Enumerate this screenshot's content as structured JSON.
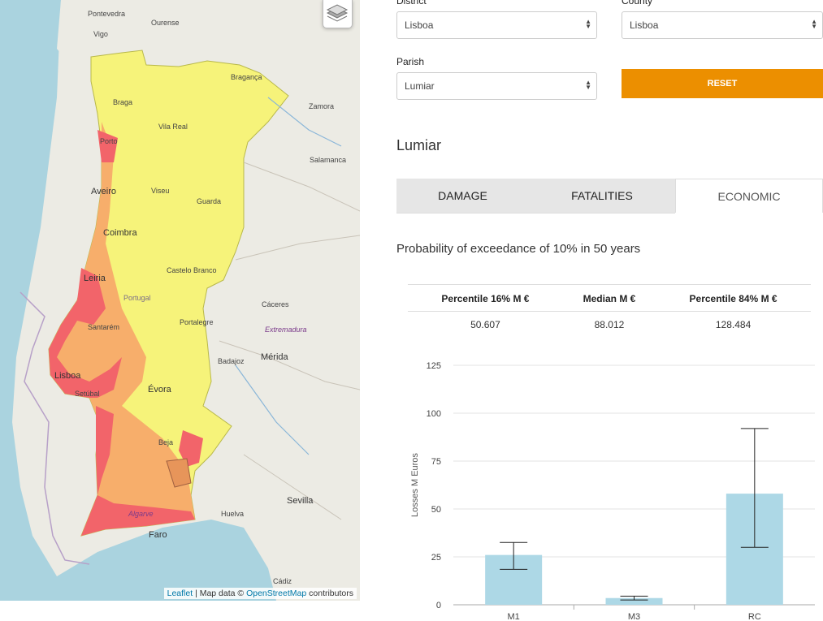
{
  "map": {
    "layers_icon": "layers-icon",
    "attribution": {
      "leaflet": "Leaflet",
      "sep": " | Map data © ",
      "osm": "OpenStreetMap",
      "tail": " contributors"
    },
    "labels": {
      "pontevedra": "Pontevedra",
      "ourense": "Ourense",
      "vigo": "Vigo",
      "braganca": "Bragança",
      "braga": "Braga",
      "zamora": "Zamora",
      "vila_real": "Vila Real",
      "porto": "Porto",
      "salamanca": "Salamanca",
      "aveiro": "Aveiro",
      "viseu": "Viseu",
      "guarda": "Guarda",
      "coimbra": "Coimbra",
      "castelo_branco": "Castelo Branco",
      "leiria": "Leiria",
      "portugal": "Portugal",
      "caceres": "Cáceres",
      "portalegre": "Portalegre",
      "santarem": "Santarém",
      "extremadura": "Extremadura",
      "badajoz": "Badajoz",
      "merida": "Mérida",
      "lisboa": "Lisboa",
      "setubal": "Setúbal",
      "evora": "Évora",
      "beja": "Beja",
      "sevilla": "Sevilla",
      "huelva": "Huelva",
      "algarve": "Algarve",
      "faro": "Faro",
      "cadiz": "Cádiz"
    }
  },
  "form": {
    "district_label": "District",
    "district_value": "Lisboa",
    "county_label": "County",
    "county_value": "Lisboa",
    "parish_label": "Parish",
    "parish_value": "Lumiar",
    "reset_label": "RESET"
  },
  "parish_title": "Lumiar",
  "tabs": [
    {
      "label": "DAMAGE"
    },
    {
      "label": "FATALITIES"
    },
    {
      "label": "ECONOMIC"
    }
  ],
  "active_tab": "ECONOMIC",
  "subtitle": "Probability of exceedance of 10% in 50 years",
  "table": {
    "headers": [
      "Percentile 16% M €",
      "Median M €",
      "Percentile 84% M €"
    ],
    "row": [
      "50.607",
      "88.012",
      "128.484"
    ]
  },
  "colors": {
    "bar": "#add8e6",
    "reset": "#ec8f00",
    "map_high": "#f2646a",
    "map_mid": "#f7ae6b",
    "map_low": "#f6f37a"
  },
  "chart_data": {
    "type": "bar",
    "categories": [
      "M1",
      "M3",
      "RC"
    ],
    "values": [
      26,
      3.5,
      58
    ],
    "error_low": [
      18.5,
      2.5,
      30
    ],
    "error_high": [
      32.5,
      4.5,
      92
    ],
    "ylabel": "Losses M Euros",
    "ylim": [
      0,
      125
    ],
    "yticks": [
      0,
      25,
      50,
      75,
      100,
      125
    ],
    "grid": true
  }
}
